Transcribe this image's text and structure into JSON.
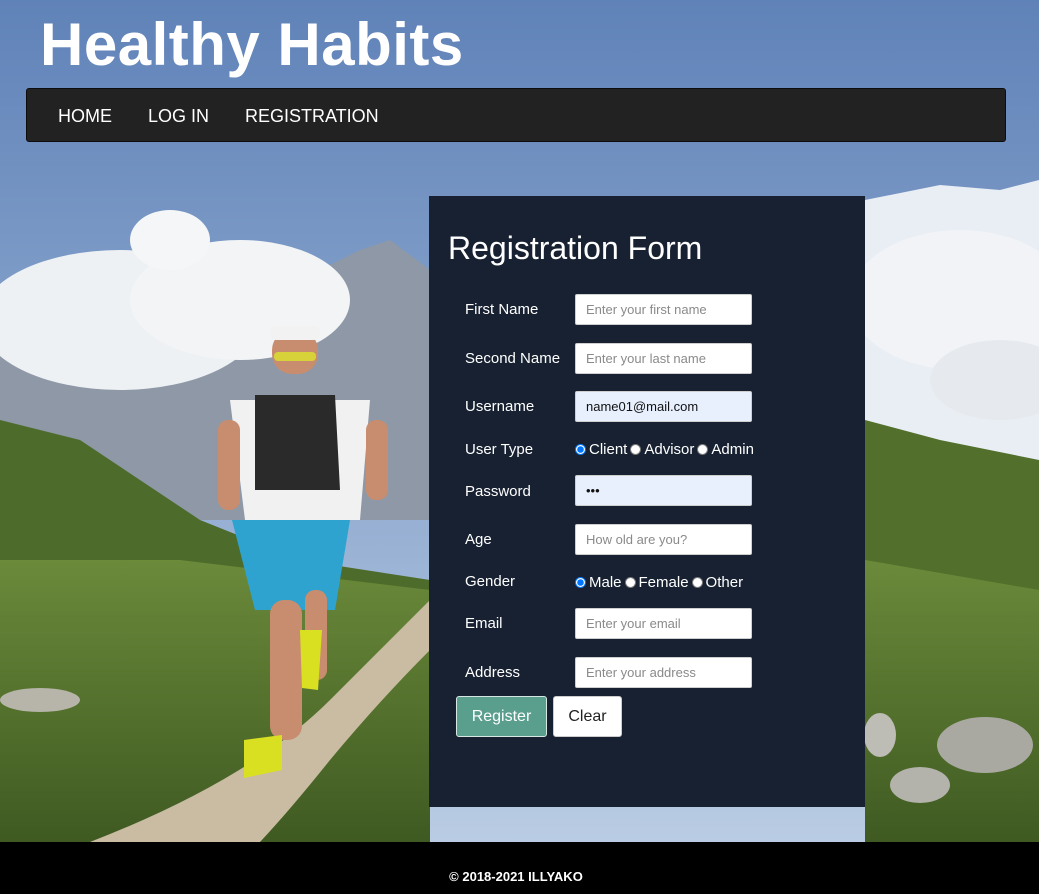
{
  "site": {
    "title": "Healthy Habits"
  },
  "nav": {
    "items": [
      {
        "label": "HOME"
      },
      {
        "label": "LOG IN"
      },
      {
        "label": "REGISTRATION"
      }
    ]
  },
  "form": {
    "title": "Registration Form",
    "first_name": {
      "label": "First Name",
      "placeholder": "Enter your first name",
      "value": ""
    },
    "second_name": {
      "label": "Second Name",
      "placeholder": "Enter your last name",
      "value": ""
    },
    "username": {
      "label": "Username",
      "placeholder": "",
      "value": "name01@mail.com"
    },
    "user_type": {
      "label": "User Type",
      "options": [
        "Client",
        "Advisor",
        "Admin"
      ],
      "selected": "Client"
    },
    "password": {
      "label": "Password",
      "value": "•••"
    },
    "age": {
      "label": "Age",
      "placeholder": "How old are you?",
      "value": ""
    },
    "gender": {
      "label": "Gender",
      "options": [
        "Male",
        "Female",
        "Other"
      ],
      "selected": "Male"
    },
    "email": {
      "label": "Email",
      "placeholder": "Enter your email",
      "value": ""
    },
    "address": {
      "label": "Address",
      "placeholder": "Enter your address",
      "value": ""
    },
    "register_label": "Register",
    "clear_label": "Clear"
  },
  "footer": {
    "text": "© 2018-2021 ILLYAKO"
  },
  "colors": {
    "navbar": "#222222",
    "form_panel": "#172131",
    "register_button": "#5a9e8d",
    "footer": "#000000"
  }
}
